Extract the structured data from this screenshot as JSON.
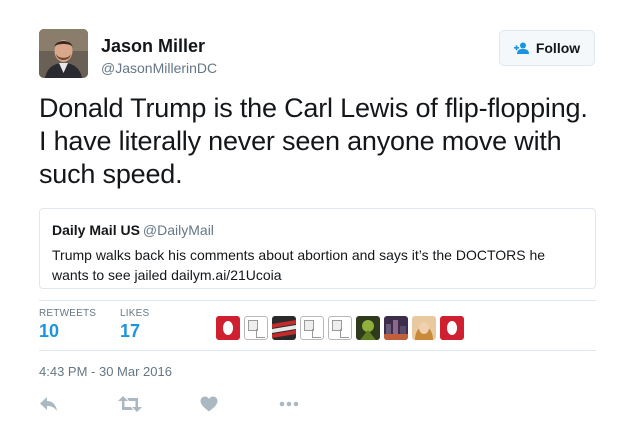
{
  "author": {
    "name": "Jason Miller",
    "handle": "@JasonMillerinDC",
    "avatar_icon": "profile-photo"
  },
  "follow_button": {
    "label": "Follow",
    "icon": "add-user-icon"
  },
  "tweet": {
    "text": "Donald Trump is the Carl Lewis of flip-flopping.  I have literally never seen anyone move with such speed."
  },
  "quoted_tweet": {
    "name": "Daily Mail US",
    "handle": "@DailyMail",
    "text": "Trump walks back his comments about abortion and says it’s the DOCTORS he wants to see jailed dailym.ai/21Ucoia"
  },
  "stats": {
    "retweets_label": "RETWEETS",
    "retweets_count": "10",
    "likes_label": "LIKES",
    "likes_count": "17"
  },
  "likers": [
    "red",
    "broken",
    "flag",
    "broken",
    "broken",
    "green",
    "city",
    "woman",
    "red"
  ],
  "timestamp": "4:43 PM - 30 Mar 2016",
  "actions": [
    "reply-icon",
    "retweet-icon",
    "like-icon",
    "more-icon"
  ],
  "colors": {
    "accent": "#1b95e0",
    "muted": "#657786",
    "border": "#e1e8ed",
    "text": "#14171a"
  }
}
